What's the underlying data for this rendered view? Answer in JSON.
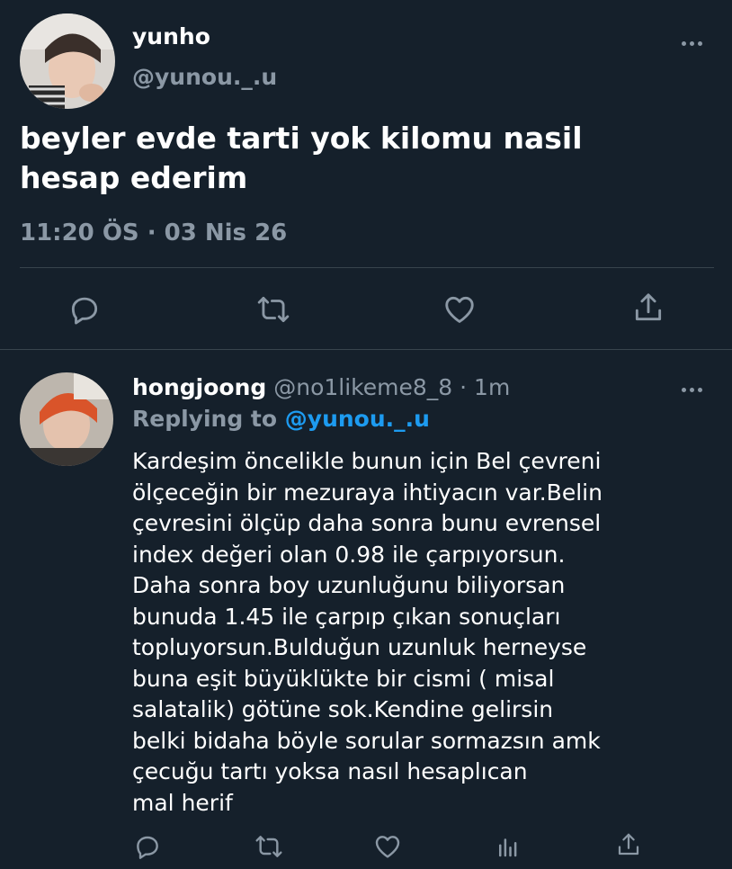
{
  "main_tweet": {
    "author_name": "yunho",
    "author_handle": "@yunou._.u",
    "text": "beyler evde tarti yok kilomu nasil hesap ederim",
    "time": "11:20 ÖS",
    "separator": "·",
    "date": "03 Nis 26"
  },
  "reply": {
    "author_name": "hongjoong",
    "author_handle": "@no1likeme8_8",
    "separator": "·",
    "age": "1m",
    "replying_prefix": "Replying to",
    "replying_to": "@yunou._.u",
    "text": "Kardeşim öncelikle bunun için Bel çevreni\nölçeceğin bir mezuraya ihtiyacın var.Belin\nçevresini ölçüp daha sonra bunu evrensel\nindex değeri olan 0.98 ile çarpıyorsun.\nDaha sonra boy uzunluğunu biliyorsan\nbunuda 1.45 ile çarpıp çıkan sonuçları\ntopluyorsun.Bulduğun uzunluk herneyse\nbuna eşit büyüklükte bir cismi ( misal\nsalatalik) götüne sok.Kendine gelirsin\nbelki bidaha böyle sorular sormazsın amk\nçecuğu tartı yoksa nasıl hesaplıcan\nmal herif"
  },
  "colors": {
    "background": "#15202b",
    "text_primary": "#ffffff",
    "text_secondary": "#8b98a5",
    "link": "#1d9bf0",
    "divider": "#38444d"
  },
  "icons": {
    "main_actions": [
      "comment-icon",
      "retweet-icon",
      "heart-icon",
      "share-icon"
    ],
    "reply_actions": [
      "comment-icon",
      "retweet-icon",
      "heart-icon",
      "analytics-icon",
      "share-icon"
    ],
    "menu": "more-icon"
  }
}
